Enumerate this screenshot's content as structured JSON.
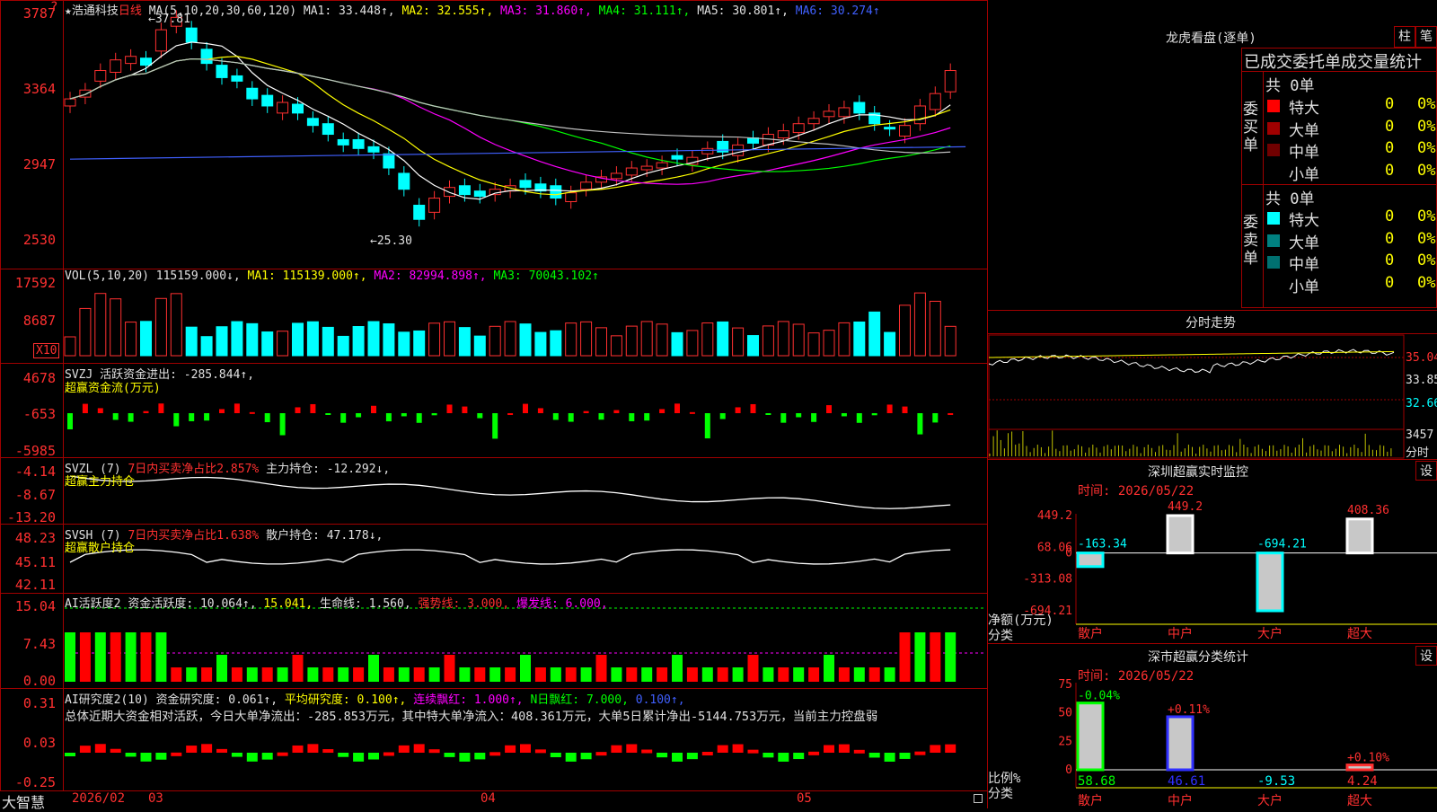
{
  "stock": {
    "star": "★",
    "name": "浩通科技",
    "period": "日线"
  },
  "main": {
    "ma_params": "MA(5,10,20,30,60,120)",
    "ma1": "MA1: 33.448↑,",
    "ma2": "MA2: 32.555↑,",
    "ma3": "MA3: 31.860↑,",
    "ma4": "MA4: 31.111↑,",
    "ma5": "MA5: 30.801↑,",
    "ma6": "MA6: 30.274↑",
    "yaxis": [
      "3787",
      "3364",
      "2947",
      "2530"
    ],
    "high_note": "←37.81",
    "low_note": "←25.30",
    "corner": "?"
  },
  "vol": {
    "params": "VOL(5,10,20)",
    "value": "115159.000↓,",
    "ma1": "MA1: 115139.000↑,",
    "ma2": "MA2: 82994.898↑,",
    "ma3": "MA3: 70043.102↑",
    "yaxis": [
      "17592",
      "8687"
    ],
    "unit": "X10"
  },
  "svzj": {
    "name": "SVZJ",
    "line1": "活跃资金进出: -285.844↑,",
    "line2": "超赢资金流(万元)",
    "yaxis": [
      "4678",
      "-653",
      "-5985"
    ]
  },
  "svzl": {
    "name": "SVZL (7)",
    "pct": "7日内买卖净占比2.857%",
    "hold": "主力持仓: -12.292↓,",
    "line2": "超赢主力持仓",
    "yaxis": [
      "-4.14",
      "-8.67",
      "-13.20"
    ]
  },
  "svsh": {
    "name": "SVSH (7)",
    "pct": "7日内买卖净占比1.638%",
    "hold": "散户持仓: 47.178↓,",
    "line2": "超赢散户持仓",
    "yaxis": [
      "48.23",
      "45.11",
      "42.11"
    ]
  },
  "ai1": {
    "name": "AI活跃度2",
    "v1": "资金活跃度: 10.064↑,",
    "v2": "15.041,",
    "v3": "生命线: 1.560,",
    "v4": "强势线: 3.000,",
    "v5": "爆发线: 6.000,",
    "yaxis": [
      "15.04",
      "7.43",
      "0.00"
    ]
  },
  "ai2": {
    "name": "AI研究度2(10)",
    "v1": "资金研究度: 0.061↑,",
    "v2": "平均研究度: 0.100↑,",
    "v3": "连续飘红: 1.000↑,",
    "v4": "N日飘红: 7.000,",
    "v5": "0.100↑,",
    "summary": "总体近期大资金相对活跃，今日大单净流出：-285.853万元，其中特大单净流入：408.361万元，大单5日累计净出-5144.753万元，当前主力控盘弱",
    "yaxis": [
      "0.31",
      "0.03",
      "-0.25"
    ]
  },
  "xaxis": {
    "brand": "大智慧",
    "labels": [
      "2026/02",
      "03",
      "04",
      "05"
    ]
  },
  "dragon": {
    "title": "龙虎看盘(逐单)",
    "btn1": "柱",
    "btn2": "笔",
    "header": "已成交委托单成交量统计",
    "buy_side": "委买单",
    "sell_side": "委卖单",
    "buy_total": "共 0单",
    "sell_total": "共 0单",
    "buy_rows": [
      {
        "label": "特大",
        "count": "0",
        "pct": "0%",
        "color": "#ff0000"
      },
      {
        "label": "大单",
        "count": "0",
        "pct": "0%",
        "color": "#a00000"
      },
      {
        "label": "中单",
        "count": "0",
        "pct": "0%",
        "color": "#700000"
      },
      {
        "label": "小单",
        "count": "0",
        "pct": "0%",
        "color": "#000000"
      }
    ],
    "sell_rows": [
      {
        "label": "特大",
        "count": "0",
        "pct": "0%",
        "color": "#00ffff"
      },
      {
        "label": "大单",
        "count": "0",
        "pct": "0%",
        "color": "#008080"
      },
      {
        "label": "中单",
        "count": "0",
        "pct": "0%",
        "color": "#007070"
      },
      {
        "label": "小单",
        "count": "0",
        "pct": "0%",
        "color": "#000000"
      }
    ]
  },
  "intraday": {
    "title": "分时走势",
    "yaxis": [
      "35.04",
      "33.85",
      "32.66"
    ],
    "vol": "3457",
    "unit": "分时"
  },
  "sz_monitor": {
    "title": "深圳超赢实时监控",
    "btn": "设",
    "time": "时间: 2026/05/22",
    "yaxis": [
      "449.2",
      "68.06",
      "0",
      "-313.08",
      "-694.21"
    ],
    "ylabel": "净额(万元)",
    "xlabel": "分类",
    "categories": [
      "散户",
      "中户",
      "大户",
      "超大"
    ],
    "values": [
      -163.34,
      449.2,
      -694.21,
      408.36
    ],
    "value_labels": [
      "-163.34",
      "449.2",
      "-694.21",
      "408.36"
    ]
  },
  "sz_class": {
    "title": "深市超赢分类统计",
    "btn": "设",
    "time": "时间: 2026/05/22",
    "yaxis": [
      "75",
      "50",
      "25",
      "0"
    ],
    "ylabel": "比例%",
    "xlabel": "分类",
    "categories": [
      "散户",
      "中户",
      "大户",
      "超大"
    ],
    "values": [
      58.68,
      46.61,
      -9.53,
      4.24
    ],
    "value_labels": [
      "58.68",
      "46.61",
      "-9.53",
      "4.24"
    ],
    "change_labels": [
      "-0.04%",
      "+0.11%",
      "",
      "+0.10%"
    ]
  },
  "colors": {
    "up": "#ff3030",
    "down": "#00ffff",
    "border": "#a00000",
    "ma1": "#ffffff",
    "ma2": "#ffff00",
    "ma3": "#ff00ff",
    "ma4": "#00ff00",
    "ma5": "#c0c0c0",
    "ma6": "#4060ff"
  }
}
